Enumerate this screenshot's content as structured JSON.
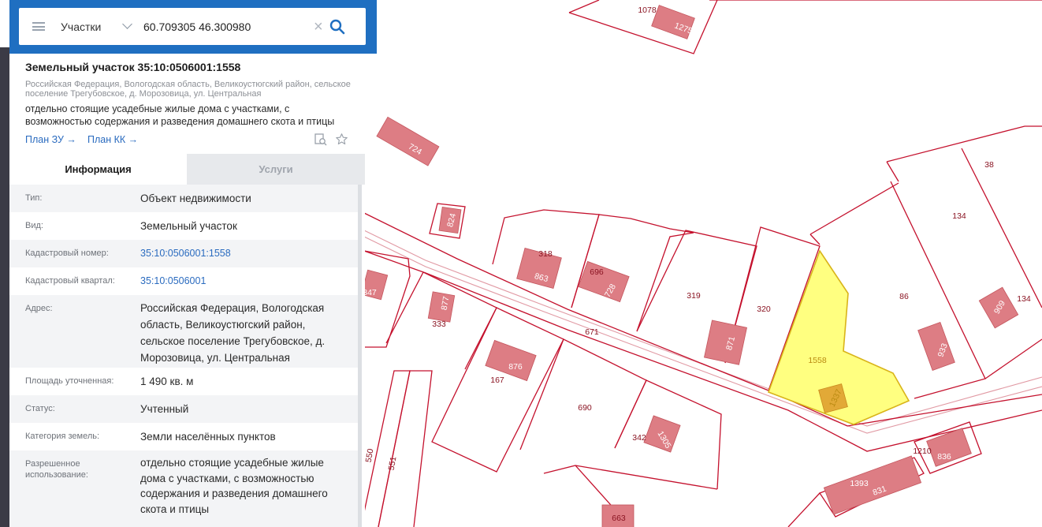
{
  "search": {
    "layer": "Участки",
    "query": "60.709305 46.300980"
  },
  "card": {
    "title": "Земельный участок 35:10:0506001:1558",
    "address": "Российская Федерация, Вологодская область, Великоустюгский район, сельское поселение Трегубовское, д. Морозовица, ул. Центральная",
    "permitted_use": "отдельно стоящие усадебные жилые дома с участками, с возможностью содержания и разведения домашнего скота и птицы",
    "plan_zu": "План ЗУ →",
    "plan_kk": "План КК →"
  },
  "tabs": {
    "info": "Информация",
    "services": "Услуги"
  },
  "info_rows": [
    {
      "label": "Тип:",
      "value": "Объект недвижимости"
    },
    {
      "label": "Вид:",
      "value": "Земельный участок"
    },
    {
      "label": "Кадастровый номер:",
      "value": "35:10:0506001:1558"
    },
    {
      "label": "Кадастровый квартал:",
      "value": "35:10:0506001"
    },
    {
      "label": "Адрес:",
      "value": "Российская Федерация, Вологодская область, Великоустюгский район, сельское поселение Трегубовское, д. Морозовица, ул. Центральная"
    },
    {
      "label": "Площадь уточненная:",
      "value": "1 490 кв. м"
    },
    {
      "label": "Статус:",
      "value": "Учтенный"
    },
    {
      "label": "Категория земель:",
      "value": "Земли населённых пунктов"
    },
    {
      "label": "Разрешенное использование:",
      "value": "отдельно стоящие усадебные жилые дома с участками, с возможностью содержания и разведения домашнего скота и птицы"
    }
  ],
  "map": {
    "labels": {
      "p1078": "1078",
      "b1275": "1275",
      "b724": "724",
      "p38": "38",
      "p134a": "134",
      "b824": "824",
      "p318": "318",
      "b863": "863",
      "p696": "696",
      "b728": "728",
      "p319": "319",
      "p320": "320",
      "b871": "871",
      "p86": "86",
      "b909": "909",
      "p134b": "134",
      "b933": "933",
      "p1558": "1558",
      "b1337": "1337",
      "b877": "877",
      "p333": "333",
      "r671": "671",
      "b876": "876",
      "p167": "167",
      "b347": "347",
      "p690": "690",
      "p342": "342",
      "b1305": "1305",
      "p1210": "1210",
      "b836": "836",
      "p1393": "1393",
      "b831": "831",
      "p550": "550",
      "p551": "551",
      "b663": "663"
    },
    "colors": {
      "plot_border": "#c4112d",
      "building": "#dd7d84",
      "selected_fill": "#ffff80",
      "accent_header": "#1f6fc1"
    }
  }
}
